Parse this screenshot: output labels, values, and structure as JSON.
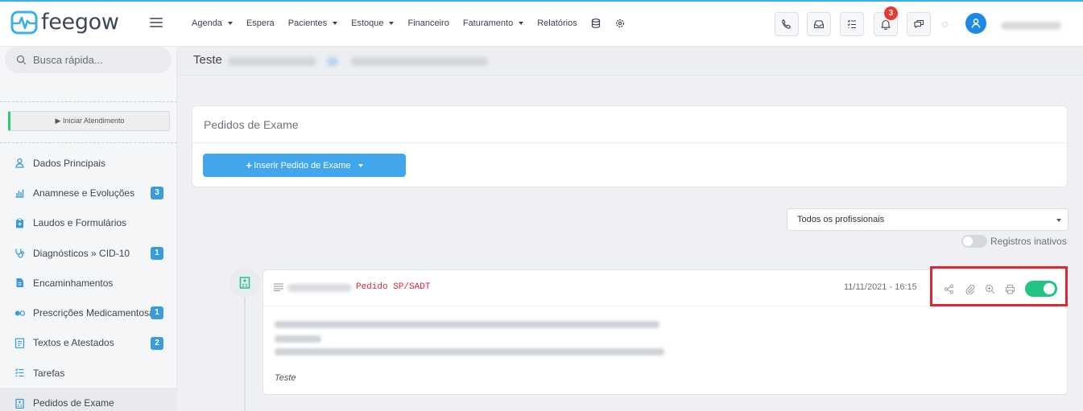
{
  "app": {
    "name": "feegow"
  },
  "nav": {
    "items": [
      {
        "label": "Agenda",
        "has_caret": true
      },
      {
        "label": "Espera",
        "has_caret": false
      },
      {
        "label": "Pacientes",
        "has_caret": true
      },
      {
        "label": "Estoque",
        "has_caret": true
      },
      {
        "label": "Financeiro",
        "has_caret": false
      },
      {
        "label": "Faturamento",
        "has_caret": true
      },
      {
        "label": "Relatórios",
        "has_caret": false
      }
    ],
    "icons": [
      "database-icon",
      "settings-icon"
    ]
  },
  "topbar": {
    "buttons": [
      "phone-icon",
      "inbox-icon",
      "checklist-icon",
      "bell-icon",
      "chat-icon"
    ],
    "notification_count": "3"
  },
  "sidebar": {
    "search_placeholder": "Busca rápida...",
    "start_button": "▶ Iniciar Atendimento",
    "items": [
      {
        "label": "Dados Principais",
        "icon": "user-icon",
        "badge": ""
      },
      {
        "label": "Anamnese e Evoluções",
        "icon": "bar-chart-icon",
        "badge": "3"
      },
      {
        "label": "Laudos e Formulários",
        "icon": "clipboard-icon",
        "badge": ""
      },
      {
        "label": "Diagnósticos » CID-10",
        "icon": "stethoscope-icon",
        "badge": "1"
      },
      {
        "label": "Encaminhamentos",
        "icon": "document-icon",
        "badge": ""
      },
      {
        "label": "Prescrições Medicamentosas",
        "icon": "pills-icon",
        "badge": "1"
      },
      {
        "label": "Textos e Atestados",
        "icon": "certificate-icon",
        "badge": "2"
      },
      {
        "label": "Tarefas",
        "icon": "tasks-icon",
        "badge": ""
      },
      {
        "label": "Pedidos de Exame",
        "icon": "hospital-icon",
        "badge": "",
        "active": true
      }
    ]
  },
  "page": {
    "title": "Teste",
    "card_title": "Pedidos de Exame",
    "insert_button": "Inserir Pedido de Exame",
    "professional_filter": "Todos os profissionais",
    "inactive_label": "Registros inativos"
  },
  "exam": {
    "type": "Pedido SP/SADT",
    "datetime": "11/11/2021 - 16:15",
    "note": "Teste",
    "actions": [
      "share-icon",
      "attachment-icon",
      "zoom-icon",
      "print-icon"
    ],
    "active": true
  },
  "colors": {
    "accent": "#42a6ec",
    "brand": "#39b0e8",
    "toggle_on": "#23c483",
    "highlight_box": "#e0262f",
    "badge": "#3a9bdc",
    "notification": "#e53935"
  }
}
